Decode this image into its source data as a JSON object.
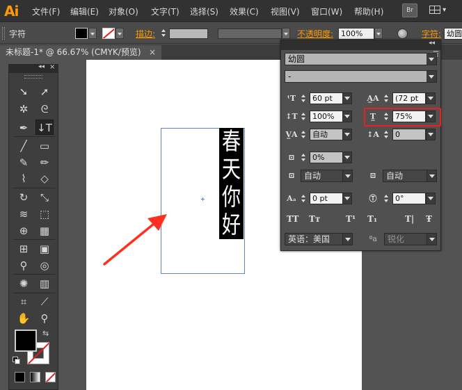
{
  "app": {
    "logo": "Ai"
  },
  "menu": [
    "文件(F)",
    "编辑(E)",
    "对象(O)",
    "文字(T)",
    "选择(S)",
    "效果(C)",
    "视图(V)",
    "窗口(W)",
    "帮助(H)"
  ],
  "menu_buttons": {
    "bridge": "Br"
  },
  "control_bar": {
    "tool_label": "字符",
    "stroke_label": "描边:",
    "opacity_label": "不透明度:",
    "opacity_value": "100%",
    "character_label": "字符:",
    "font_value": "幼圆"
  },
  "document_tab": {
    "title": "未标题-1* @ 66.67% (CMYK/预览)",
    "close": "×"
  },
  "artwork_text": [
    "春",
    "天",
    "你",
    "好"
  ],
  "tools_panel": {
    "collapse": "◂◂",
    "close": "×"
  },
  "character_panel": {
    "collapse": "◂◂",
    "menu_icon": "▾☰",
    "font_family": "幼圆",
    "font_style": "-",
    "font_size": "60 pt",
    "leading": "(72 pt",
    "vertical_scale": "100%",
    "horizontal_scale": "75%",
    "tracking": "自动",
    "kerning": "0",
    "tsume": "0%",
    "aki_left": "自动",
    "aki_right": "自动",
    "baseline_shift": "0 pt",
    "rotation": "0°",
    "style_buttons": [
      "TT",
      "Tт",
      "T¹",
      "T₁",
      "T|",
      "Ŧ"
    ],
    "language": "英语：美国",
    "antialias_icon": "ªa",
    "antialias": "锐化"
  },
  "colors": {
    "accent": "#ff9a00",
    "highlight": "#e82020",
    "arrow": "#ff3020",
    "frame": "#5b84d4"
  }
}
